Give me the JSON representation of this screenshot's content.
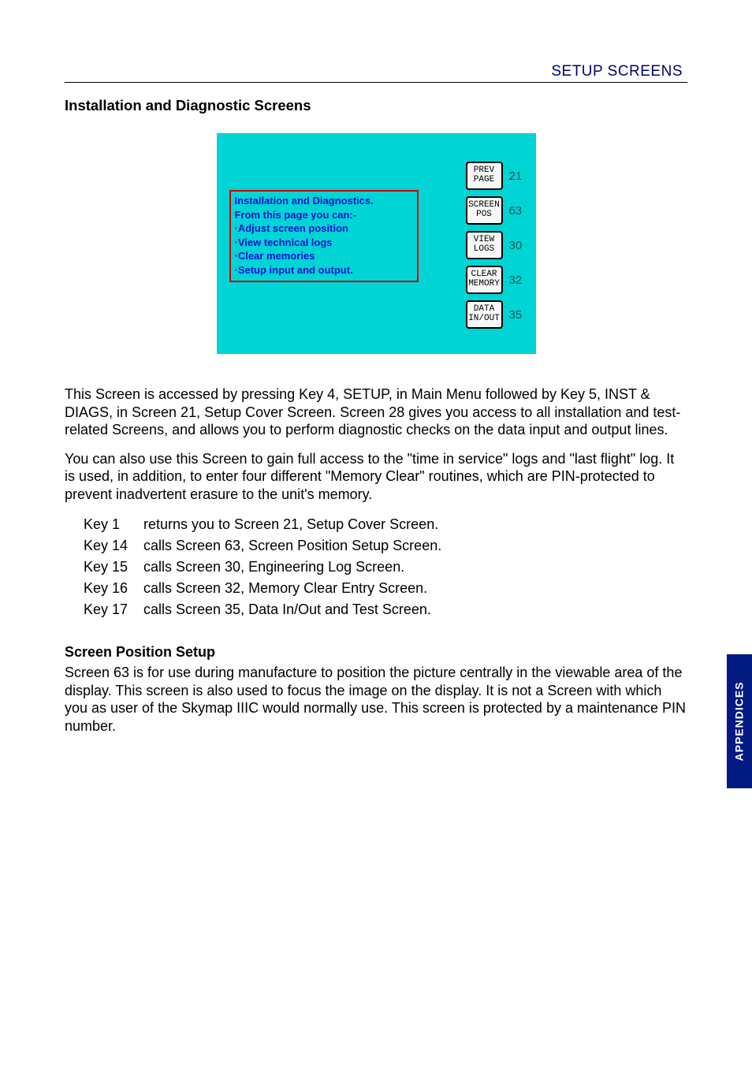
{
  "header": {
    "right_text": "SETUP SCREENS"
  },
  "section": {
    "heading": "Installation and Diagnostic Screens"
  },
  "figure": {
    "info_lines": [
      "Installation and Diagnostics.",
      "From this page you can:-",
      "·Adjust screen position",
      "·View technical logs",
      "·Clear memories",
      "·Setup input and output."
    ],
    "buttons": [
      {
        "line1": "PREV",
        "line2": "PAGE",
        "num": "21"
      },
      {
        "line1": "SCREEN",
        "line2": "POS",
        "num": "63"
      },
      {
        "line1": "VIEW",
        "line2": "LOGS",
        "num": "30"
      },
      {
        "line1": "CLEAR",
        "line2": "MEMORY",
        "num": "32"
      },
      {
        "line1": "DATA",
        "line2": "IN/OUT",
        "num": "35"
      }
    ]
  },
  "body": {
    "para1": "This Screen is accessed by pressing Key 4, SETUP, in Main Menu followed by Key 5, INST & DIAGS, in Screen 21, Setup Cover Screen.  Screen 28 gives you access to all installation and test-related Screens, and allows you to perform diagnostic checks on the data input and output lines.",
    "para2": "You can also use this Screen to gain full access to the \"time in service\" logs and \"last flight\" log.  It is used, in addition, to enter four different \"Memory Clear\" routines, which are PIN-protected to prevent inadvertent erasure to the unit's memory."
  },
  "keys": [
    {
      "key": "Key 1",
      "desc": "returns you to Screen 21, Setup Cover Screen."
    },
    {
      "key": "Key 14",
      "desc": "calls Screen 63, Screen Position Setup Screen."
    },
    {
      "key": "Key 15",
      "desc": "calls Screen 30, Engineering Log Screen."
    },
    {
      "key": "Key 16",
      "desc": "calls Screen 32, Memory Clear Entry Screen."
    },
    {
      "key": "Key 17",
      "desc": "calls Screen 35, Data In/Out and Test Screen."
    }
  ],
  "sub_section": {
    "heading": "Screen Position Setup",
    "para": "Screen 63 is for use during manufacture to position the picture centrally in the viewable area of the display.  This screen is also used to focus the image on the display.  It is not a Screen with which you as user of the Skymap IIIC would normally use.  This screen is protected by a maintenance PIN number."
  },
  "side_tab": "APPENDICES"
}
